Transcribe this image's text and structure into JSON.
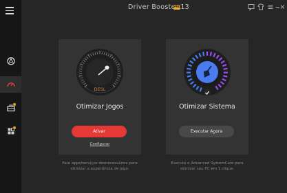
{
  "app": {
    "title": "Driver Booster 13",
    "badge": "PRO"
  },
  "titlebar": {
    "icons": [
      "chat-icon",
      "shirt-icon",
      "menu-icon",
      "minimize-icon",
      "close-icon"
    ]
  },
  "sidebar": {
    "items": [
      {
        "name": "sidebar-item-scan",
        "icon": "refresh-ring-icon",
        "active": false,
        "badge": false
      },
      {
        "name": "sidebar-item-boost",
        "icon": "speedometer-icon",
        "active": true,
        "badge": false
      },
      {
        "name": "sidebar-item-action-center",
        "icon": "toolbox-icon",
        "active": false,
        "badge": true
      },
      {
        "name": "sidebar-item-tools",
        "icon": "apps-icon",
        "active": false,
        "badge": true
      }
    ]
  },
  "cards": [
    {
      "title": "Otimizar Jogos",
      "gauge_label": "DESL",
      "button": "Ativar",
      "link": "Configurar",
      "description": "Pare apps/serviços desnecessários para otimizar a experiência de jogo."
    },
    {
      "title": "Otimizar Sistema",
      "button": "Executar Agora",
      "description": "Execute o Advanced SystemCare para otimizar seu PC em 1 clique."
    }
  ],
  "colors": {
    "accent_red": "#e53935",
    "badge_orange": "#e8a020",
    "gauge_orange": "#d9893a",
    "ring_blue": "#4a7cf0",
    "ring_purple": "#9a4df0"
  }
}
